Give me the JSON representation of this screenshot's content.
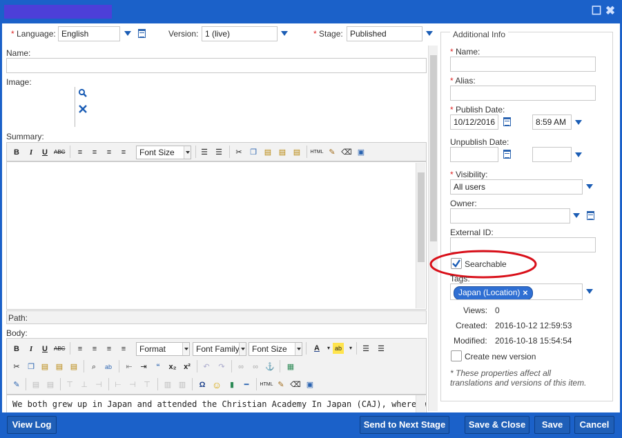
{
  "titlebar": {
    "maximize_icon": "maximize-icon",
    "close_icon": "close-icon"
  },
  "top": {
    "language_label": "Language:",
    "language_value": "English",
    "version_label": "Version:",
    "version_value": "1 (live)",
    "stage_label": "Stage:",
    "stage_value": "Published",
    "required_mark": "*"
  },
  "left": {
    "name_label": "Name:",
    "image_label": "Image:",
    "summary_label": "Summary:",
    "path_label": "Path:",
    "body_label": "Body:",
    "font_size": "Font Size",
    "format": "Format",
    "font_family": "Font Family",
    "html_btn": "HTML",
    "body_text": "We both grew up in Japan and attended the Christian Academy In Japan (CAJ), where we are"
  },
  "right": {
    "legend": "Additional Info",
    "name_label": "Name:",
    "alias_label": "Alias:",
    "publish_date_label": "Publish Date:",
    "publish_date": "10/12/2016",
    "publish_time": "8:59 AM",
    "unpublish_date_label": "Unpublish Date:",
    "visibility_label": "Visibility:",
    "visibility_value": "All users",
    "owner_label": "Owner:",
    "external_id_label": "External ID:",
    "searchable_label": "Searchable",
    "tags_label": "Tags:",
    "tag_chip": "Japan (Location)",
    "views_label": "Views:",
    "views_value": "0",
    "created_label": "Created:",
    "created_value": "2016-10-12 12:59:53",
    "modified_label": "Modified:",
    "modified_value": "2016-10-18 15:54:54",
    "create_version_label": "Create new version",
    "note_line1": "* These properties affect all",
    "note_line2": "translations and versions of this item."
  },
  "footer": {
    "view_log": "View Log",
    "send_next": "Send to Next Stage",
    "save_close": "Save & Close",
    "save": "Save",
    "cancel": "Cancel"
  },
  "colors": {
    "accent": "#1b61c9",
    "highlight_ellipse": "#d9101a",
    "chip": "#2f6fd3"
  }
}
